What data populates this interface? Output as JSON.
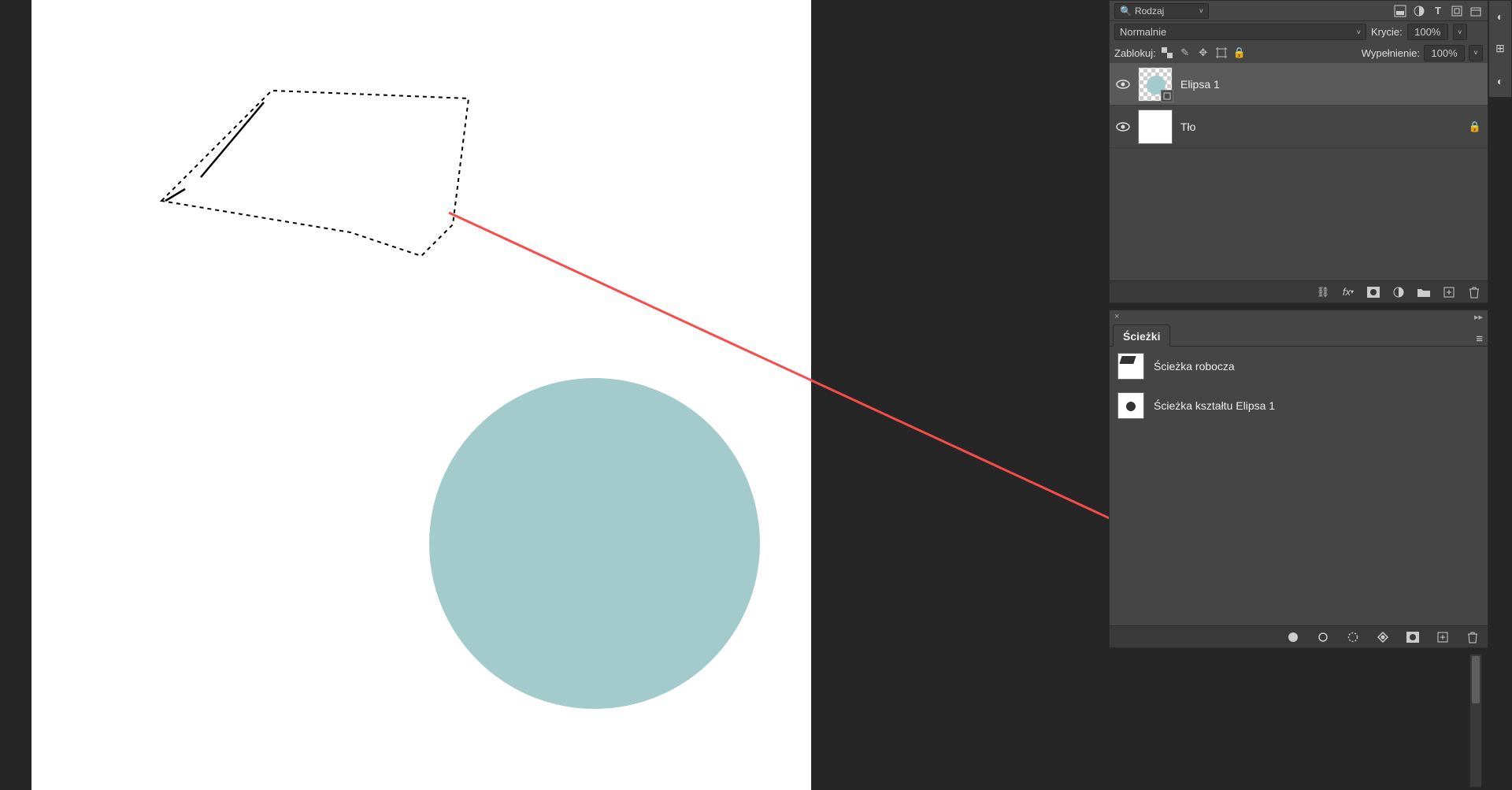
{
  "filter": {
    "search_icon": "search-icon",
    "label": "Rodzaj"
  },
  "blend": {
    "mode": "Normalnie",
    "opacity_label": "Krycie:",
    "opacity_value": "100%"
  },
  "lock": {
    "label": "Zablokuj:",
    "fill_label": "Wypełnienie:",
    "fill_value": "100%"
  },
  "layers": [
    {
      "name": "Elipsa 1",
      "selected": true,
      "locked": false,
      "type": "shape"
    },
    {
      "name": "Tło",
      "selected": false,
      "locked": true,
      "type": "bg"
    }
  ],
  "paths_panel": {
    "title": "Ścieżki",
    "items": [
      {
        "name": "Ścieżka robocza"
      },
      {
        "name": "Ścieżka kształtu Elipsa 1"
      }
    ]
  }
}
